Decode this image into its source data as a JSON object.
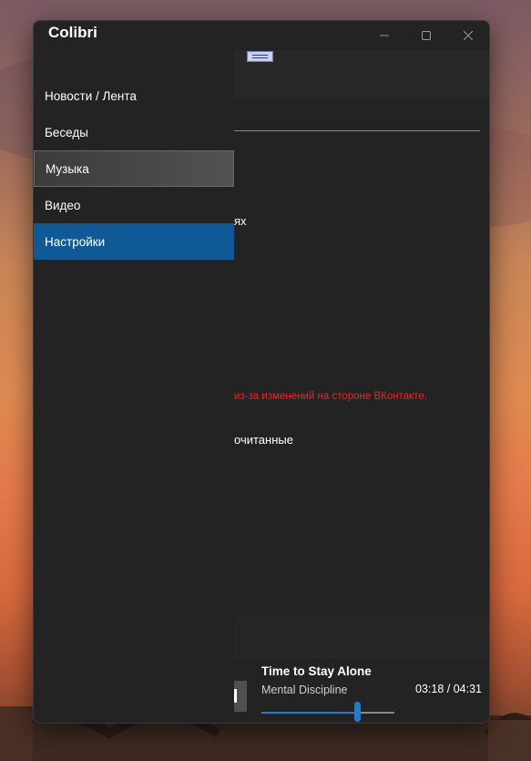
{
  "window": {
    "title": "Colibri"
  },
  "caption": {
    "minimize_icon": "minimize-icon",
    "maximize_icon": "maximize-icon",
    "close_icon": "close-icon"
  },
  "nav": {
    "items": [
      {
        "label": "Новости / Лента",
        "state": "normal"
      },
      {
        "label": "Беседы",
        "state": "normal"
      },
      {
        "label": "Музыка",
        "state": "hover"
      },
      {
        "label": "Видео",
        "state": "normal"
      },
      {
        "label": "Настройки",
        "state": "selected"
      }
    ]
  },
  "content": {
    "menu_icon": "hamburger-icon",
    "fragment_1": "ях",
    "warning_fragment": "из-за изменений на стороне ВКонтакте.",
    "fragment_2": "очитанные"
  },
  "player": {
    "title": "Time to Stay Alone",
    "artist": "Mental Discipline",
    "time": "03:18 / 04:31",
    "progress": 0.721,
    "accent_color": "#1a7fd4"
  },
  "colors": {
    "selected": "#0f5a96",
    "warning": "#e02b2b",
    "window_bg": "#232323"
  }
}
